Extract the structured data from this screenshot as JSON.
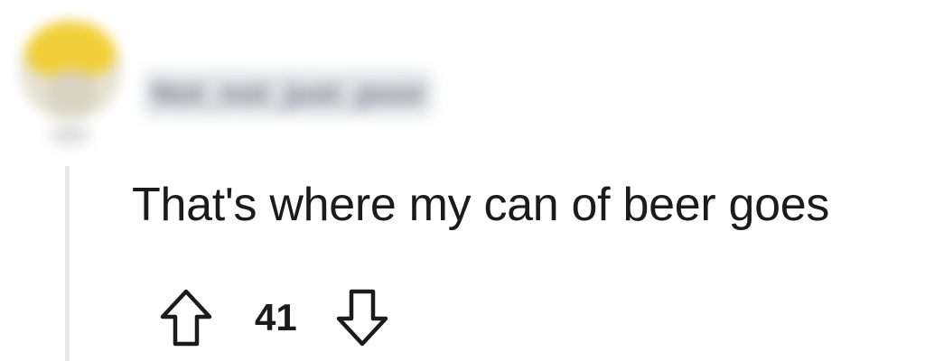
{
  "comment": {
    "username": "Not_not_just_poor",
    "text": "That's where my can of beer goes",
    "score": "41"
  },
  "icons": {
    "upvote": "upvote-arrow-icon",
    "downvote": "downvote-arrow-icon"
  },
  "colors": {
    "text": "#1b1b1b",
    "thread_line": "#e6e6e6",
    "avatar_accent": "#f1cf38"
  }
}
